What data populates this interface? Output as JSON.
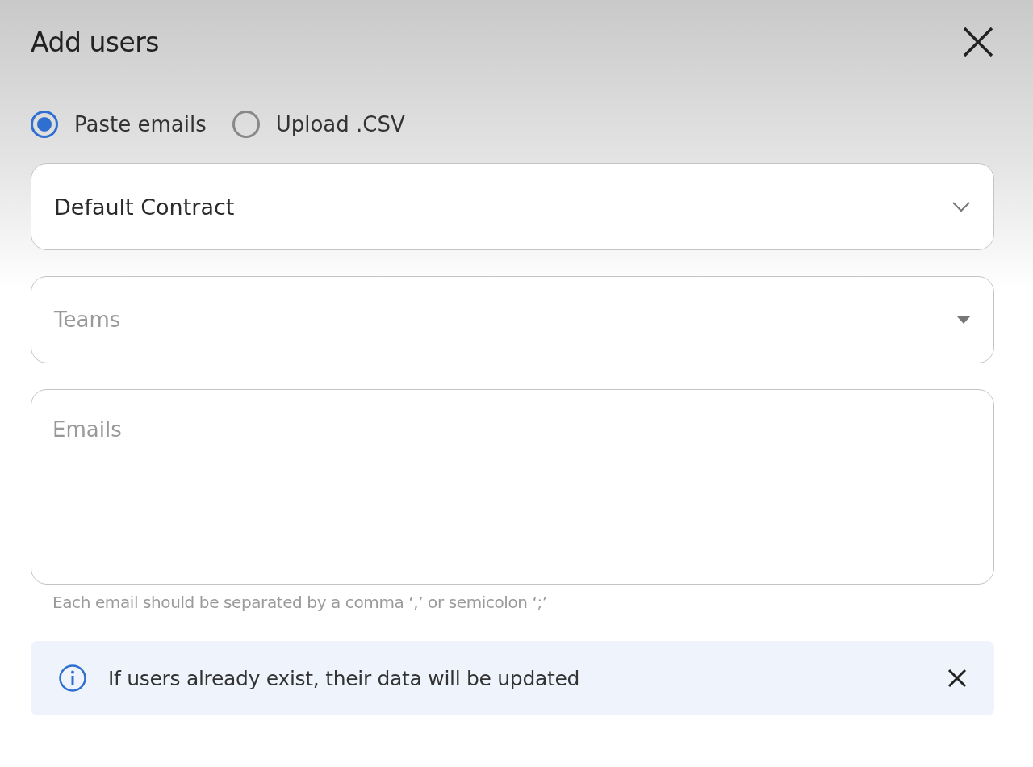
{
  "dialog": {
    "title": "Add users"
  },
  "modes": [
    {
      "label": "Paste emails",
      "selected": true
    },
    {
      "label": "Upload .CSV",
      "selected": false
    }
  ],
  "contract_select": {
    "value": "Default Contract"
  },
  "teams_select": {
    "placeholder": "Teams"
  },
  "emails_field": {
    "placeholder": "Emails",
    "helper": "Each email should be separated by a comma ‘,’ or semicolon ‘;’"
  },
  "notice": {
    "text": "If users already exist, their data will be updated"
  }
}
